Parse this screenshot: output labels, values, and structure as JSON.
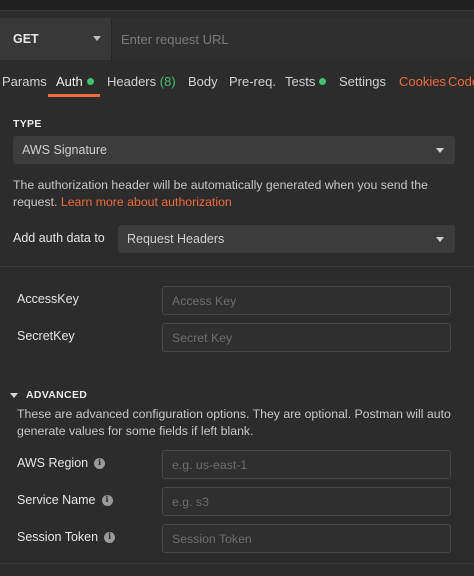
{
  "request": {
    "method": "GET",
    "url_placeholder": "Enter request URL"
  },
  "tabs": [
    {
      "label": "Params"
    },
    {
      "label": "Auth",
      "active": true,
      "dot": "#3ec270"
    },
    {
      "label": "Headers",
      "count": "(8)"
    },
    {
      "label": "Body"
    },
    {
      "label": "Pre-req."
    },
    {
      "label": "Tests",
      "dot": "#3ec270"
    },
    {
      "label": "Settings"
    },
    {
      "label": "Cookies",
      "color": "#f26b3a"
    },
    {
      "label": "Code",
      "color": "#f26b3a"
    }
  ],
  "auth": {
    "type_label": "TYPE",
    "type_value": "AWS Signature",
    "description": "The authorization header will be automatically generated when you send the request.",
    "learn_more": "Learn more about authorization",
    "add_to_label": "Add auth data to",
    "add_to_value": "Request Headers"
  },
  "credentials": {
    "access_key_label": "AccessKey",
    "access_key_placeholder": "Access Key",
    "secret_key_label": "SecretKey",
    "secret_key_placeholder": "Secret Key"
  },
  "advanced": {
    "heading": "ADVANCED",
    "description": "These are advanced configuration options. They are optional. Postman will auto generate values for some fields if left blank.",
    "region_label": "AWS Region",
    "region_placeholder": "e.g. us-east-1",
    "service_label": "Service Name",
    "service_placeholder": "e.g. s3",
    "session_label": "Session Token",
    "session_placeholder": "Session Token"
  },
  "colors": {
    "accent": "#f26b3a",
    "status_green": "#3ec270",
    "background": "#2c2c2c"
  }
}
